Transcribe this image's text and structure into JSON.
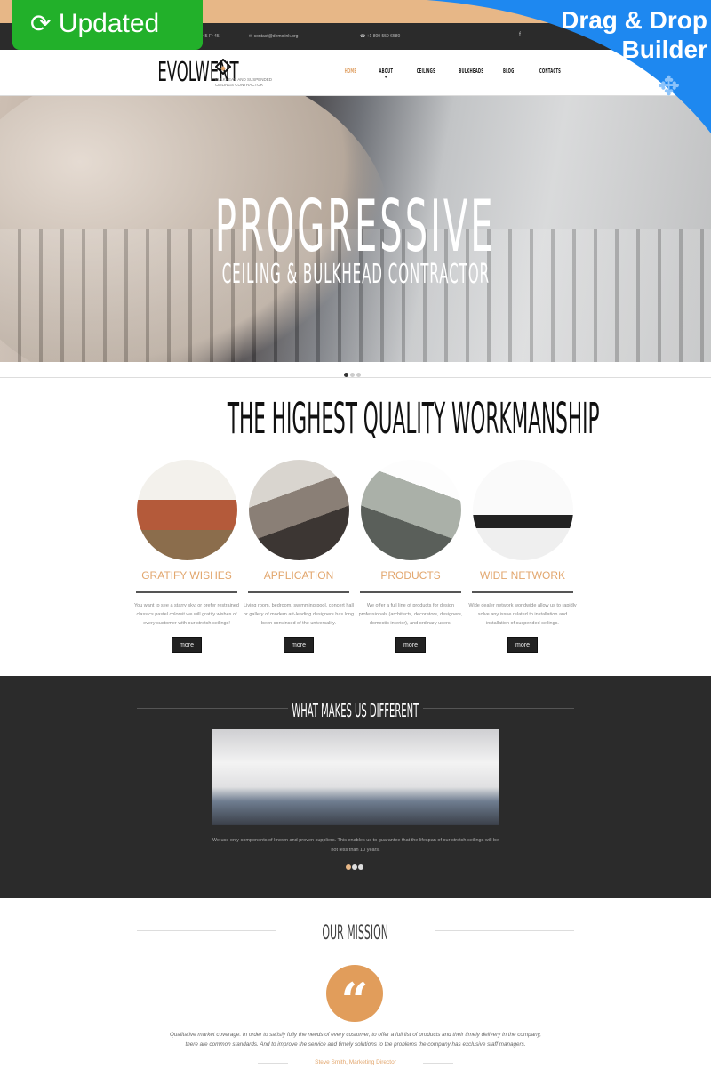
{
  "badges": {
    "updated": "Updated",
    "builder_line1": "Drag & Drop",
    "builder_line2": "Builder"
  },
  "topbar": {
    "hours": "45 Fr 45",
    "email": "contact@demolink.org",
    "phone": "+1 800 559 6580"
  },
  "header": {
    "logo": "EVOLWENT",
    "tagline_1": "BULKHEAD AND SUSPENDED",
    "tagline_2": "CEILINGS CONTRACTOR",
    "nav": [
      "HOME",
      "ABOUT",
      "CEILINGS",
      "BULKHEADS",
      "BLOG",
      "CONTACTS"
    ],
    "active_color": "#e2a66d"
  },
  "hero": {
    "title": "PROGRESSIVE",
    "subtitle": "CEILING & BULKHEAD CONTRACTOR",
    "slides": 3,
    "active_slide": 1
  },
  "quality": {
    "title": "THE HIGHEST QUALITY WORKMANSHIP",
    "features": [
      {
        "title": "GRATIFY WISHES",
        "text": "You want to see a starry sky, or prefer restrained classics pastel colorsit we will gratify wishes of every customer with our stretch ceilings!",
        "button": "more"
      },
      {
        "title": "APPLICATION",
        "text": "Living room, bedroom, swimming pool, concert hall or gallery of modern art-leading designers has long been convinced of the universality.",
        "button": "more"
      },
      {
        "title": "PRODUCTS",
        "text": "We offer a full line of products for design professionals (architects, decorators, designers, domestic interior), and ordinary users.",
        "button": "more"
      },
      {
        "title": "WIDE NETWORK",
        "text": "Wide dealer network worldwide allow us to rapidly solve any issue related to installation and installation of suspended ceilings.",
        "button": "more"
      }
    ]
  },
  "different": {
    "title": "WHAT MAKES US DIFFERENT",
    "text": "We use only components of known and proven suppliers. This enables us to guarantee that the lifespan of our stretch ceilings will be not less than 10 years.",
    "slides": 3,
    "active_slide": 1
  },
  "mission": {
    "title": "OUR MISSION",
    "quote_icon": "quote-icon",
    "quote": "Qualitative market coverage. In order to satisfy fully the needs of every customer, to offer a full list of products and their timely delivery in the company, there are common standards. And to improve the service and timely solutions to the problems the company has exclusive staff managers.",
    "author": "Steve Smith, Marketing Director"
  },
  "colors": {
    "accent": "#e2a66d",
    "dark": "#2b2b2b",
    "updated_green": "#22b02a",
    "builder_blue": "#1e88f0"
  }
}
